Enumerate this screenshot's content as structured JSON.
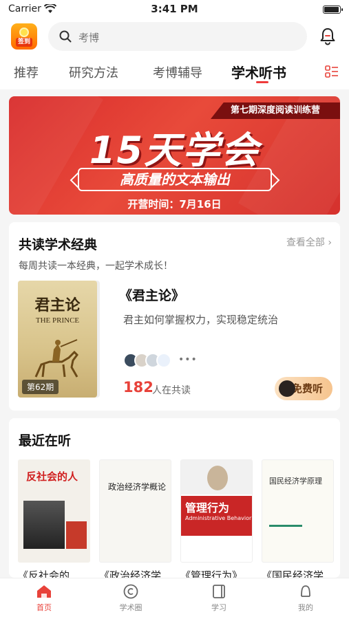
{
  "status_bar": {
    "carrier": "Carrier",
    "time": "3:41 PM"
  },
  "header": {
    "signin_label": "签到",
    "search_placeholder": "考博",
    "icons": {
      "search": "search-icon",
      "notification": "bell-icon",
      "menu": "grid-menu-icon"
    }
  },
  "tabs": [
    {
      "label": "推荐",
      "active": false
    },
    {
      "label": "研究方法",
      "active": false
    },
    {
      "label": "考博辅导",
      "active": false
    },
    {
      "label": "学术听书",
      "active": true
    }
  ],
  "banner": {
    "tag": "第七期深度阅读训练营",
    "headline": "15天学会",
    "subline": "高质量的文本输出",
    "date": "开营时间：7月16日"
  },
  "coread": {
    "title": "共读学术经典",
    "see_all": "查看全部 ›",
    "subtitle": "每周共读一本经典，一起学术成长！",
    "book": {
      "cover_title": "君主论",
      "cover_en": "THE PRINCE",
      "issue": "第62期",
      "title": "《君主论》",
      "description": "君主如何掌握权力，实现稳定统治",
      "reader_count": "182",
      "reader_label": "人在共读",
      "listen_button": "免费听"
    }
  },
  "recent": {
    "title": "最近在听",
    "books": [
      {
        "name": "《反社会的",
        "cover_text": "反社会的人"
      },
      {
        "name": "《政治经济学",
        "cover_text": "政治经济学概论"
      },
      {
        "name": "《管理行为》",
        "cover_text": "管理行为",
        "cover_en": "Administrative Behavior"
      },
      {
        "name": "《国民经济学",
        "cover_text": "国民经济学原理"
      }
    ]
  },
  "bottom_nav": [
    {
      "label": "首页",
      "icon": "home-icon",
      "active": true
    },
    {
      "label": "学术圈",
      "icon": "circle-c-icon",
      "active": false
    },
    {
      "label": "学习",
      "icon": "book-icon",
      "active": false
    },
    {
      "label": "我的",
      "icon": "profile-icon",
      "active": false
    }
  ],
  "colors": {
    "accent": "#e8423a",
    "banner": "#d92c2c",
    "listen_button": "#f6c48e"
  }
}
